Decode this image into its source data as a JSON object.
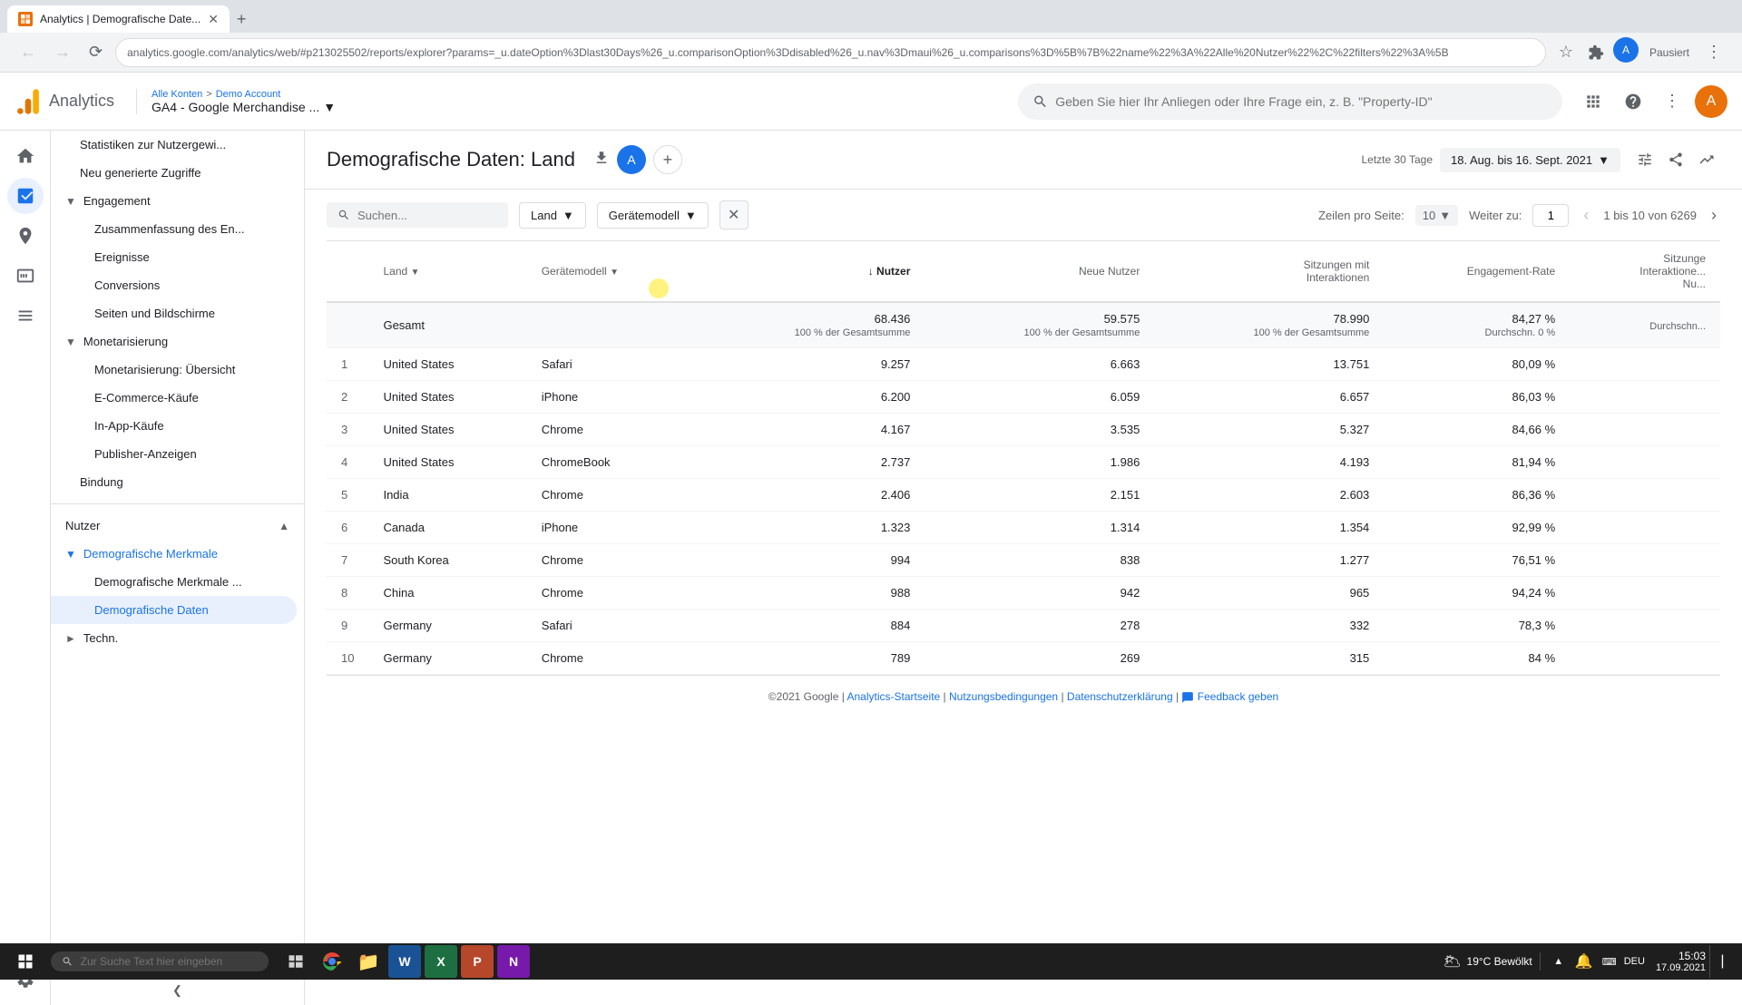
{
  "browser": {
    "tab_title": "Analytics | Demografische Date...",
    "tab_favicon": "GA",
    "url": "analytics.google.com/analytics/web/#p213025502/reports/explorer?params=_u.dateOption%3Dlast30Days%26_u.comparisonOption%3Ddisabled%26_u.nav%3Dmaui%26_u.comparisons%3D%5B%7B%22name%22%3A%22Alle%20Nutzer%22%2C%22filters%22%3A%5B",
    "pause_label": "Pausiert"
  },
  "header": {
    "app_name": "Analytics",
    "breadcrumb_all": "Alle Konten",
    "breadcrumb_sep": ">",
    "breadcrumb_account": "Demo Account",
    "property": "GA4 - Google Merchandise ...",
    "search_placeholder": "Geben Sie hier Ihr Anliegen oder Ihre Frage ein, z. B. \"Property-ID\"",
    "avatar": "A"
  },
  "page": {
    "title": "Demografische Daten: Land",
    "date_label": "Letzte 30 Tage",
    "date_value": "18. Aug. bis 16. Sept. 2021"
  },
  "sidebar": {
    "nav_icons": [
      "home",
      "chart",
      "target",
      "grid",
      "menu"
    ],
    "sections": [
      {
        "label": "Statistiken zur Nutzergewi...",
        "indent": 0,
        "type": "item"
      },
      {
        "label": "Neu generierte Zugriffe",
        "indent": 0,
        "type": "item"
      },
      {
        "label": "Engagement",
        "indent": 0,
        "type": "section",
        "expanded": true
      },
      {
        "label": "Zusammenfassung des En...",
        "indent": 1,
        "type": "item"
      },
      {
        "label": "Ereignisse",
        "indent": 1,
        "type": "item"
      },
      {
        "label": "Conversions",
        "indent": 1,
        "type": "item"
      },
      {
        "label": "Seiten und Bildschirme",
        "indent": 1,
        "type": "item"
      },
      {
        "label": "Monetarisierung",
        "indent": 0,
        "type": "section",
        "expanded": true
      },
      {
        "label": "Monetarisierung: Übersicht",
        "indent": 1,
        "type": "item"
      },
      {
        "label": "E-Commerce-Käufe",
        "indent": 1,
        "type": "item"
      },
      {
        "label": "In-App-Käufe",
        "indent": 1,
        "type": "item"
      },
      {
        "label": "Publisher-Anzeigen",
        "indent": 1,
        "type": "item"
      },
      {
        "label": "Bindung",
        "indent": 0,
        "type": "item"
      }
    ],
    "nutzer_section": {
      "label": "Nutzer",
      "subsections": [
        {
          "label": "Demografische Merkmale",
          "expanded": true,
          "items": [
            {
              "label": "Demografische Merkmale ...",
              "active": false
            },
            {
              "label": "Demografische Daten",
              "active": true
            }
          ]
        },
        {
          "label": "Techn.",
          "expanded": false
        }
      ]
    },
    "collapse_btn": "<"
  },
  "table": {
    "search_placeholder": "Suchen...",
    "filter_land": "Land",
    "filter_geraet": "Gerätemodell",
    "pagination": {
      "per_page_label": "Zeilen pro Seite:",
      "per_page": "10",
      "go_to_label": "Weiter zu:",
      "current_page": "1",
      "total_info": "1 bis 10 von 6269"
    },
    "columns": [
      {
        "id": "idx",
        "label": "#",
        "align": "left"
      },
      {
        "id": "land",
        "label": "Land",
        "align": "left"
      },
      {
        "id": "geraet",
        "label": "Gerätemodell",
        "align": "left"
      },
      {
        "id": "nutzer",
        "label": "↓ Nutzer",
        "align": "right",
        "sortable": true
      },
      {
        "id": "neue_nutzer",
        "label": "Neue Nutzer",
        "align": "right"
      },
      {
        "id": "sitzungen",
        "label": "Sitzungen mit Interaktionen",
        "align": "right"
      },
      {
        "id": "engagement",
        "label": "Engagement-Rate",
        "align": "right"
      },
      {
        "id": "sitzungen2",
        "label": "Sitzungen Interaktione... Nu...",
        "align": "right"
      }
    ],
    "total_row": {
      "label": "Gesamt",
      "nutzer": "68.436",
      "nutzer_sub": "100 % der Gesamtsumme",
      "neue_nutzer": "59.575",
      "neue_nutzer_sub": "100 % der Gesamtsumme",
      "sitzungen": "78.990",
      "sitzungen_sub": "100 % der Gesamtsumme",
      "engagement": "84,27 %",
      "engagement_sub": "Durchschn. 0 %",
      "sitzungen2": "Durchschn..."
    },
    "rows": [
      {
        "idx": 1,
        "land": "United States",
        "geraet": "Safari",
        "nutzer": "9.257",
        "neue_nutzer": "6.663",
        "sitzungen": "13.751",
        "engagement": "80,09 %",
        "sitzungen2": ""
      },
      {
        "idx": 2,
        "land": "United States",
        "geraet": "iPhone",
        "nutzer": "6.200",
        "neue_nutzer": "6.059",
        "sitzungen": "6.657",
        "engagement": "86,03 %",
        "sitzungen2": ""
      },
      {
        "idx": 3,
        "land": "United States",
        "geraet": "Chrome",
        "nutzer": "4.167",
        "neue_nutzer": "3.535",
        "sitzungen": "5.327",
        "engagement": "84,66 %",
        "sitzungen2": ""
      },
      {
        "idx": 4,
        "land": "United States",
        "geraet": "ChromeBook",
        "nutzer": "2.737",
        "neue_nutzer": "1.986",
        "sitzungen": "4.193",
        "engagement": "81,94 %",
        "sitzungen2": ""
      },
      {
        "idx": 5,
        "land": "India",
        "geraet": "Chrome",
        "nutzer": "2.406",
        "neue_nutzer": "2.151",
        "sitzungen": "2.603",
        "engagement": "86,36 %",
        "sitzungen2": ""
      },
      {
        "idx": 6,
        "land": "Canada",
        "geraet": "iPhone",
        "nutzer": "1.323",
        "neue_nutzer": "1.314",
        "sitzungen": "1.354",
        "engagement": "92,99 %",
        "sitzungen2": ""
      },
      {
        "idx": 7,
        "land": "South Korea",
        "geraet": "Chrome",
        "nutzer": "994",
        "neue_nutzer": "838",
        "sitzungen": "1.277",
        "engagement": "76,51 %",
        "sitzungen2": ""
      },
      {
        "idx": 8,
        "land": "China",
        "geraet": "Chrome",
        "nutzer": "988",
        "neue_nutzer": "942",
        "sitzungen": "965",
        "engagement": "94,24 %",
        "sitzungen2": ""
      },
      {
        "idx": 9,
        "land": "Germany",
        "geraet": "Safari",
        "nutzer": "884",
        "neue_nutzer": "278",
        "sitzungen": "332",
        "engagement": "78,3 %",
        "sitzungen2": ""
      },
      {
        "idx": 10,
        "land": "Germany",
        "geraet": "Chrome",
        "nutzer": "789",
        "neue_nutzer": "269",
        "sitzungen": "315",
        "engagement": "84 %",
        "sitzungen2": ""
      }
    ]
  },
  "footer": {
    "copyright": "©2021 Google",
    "links": [
      "Analytics-Startseite",
      "Nutzungsbedingungen",
      "Datenschutzerklärung",
      "Feedback geben"
    ]
  },
  "taskbar": {
    "search_placeholder": "Zur Suche Text hier eingeben",
    "time": "15:03",
    "date": "17.09.2021",
    "weather": "19°C  Bewölkt",
    "lang": "DEU"
  }
}
